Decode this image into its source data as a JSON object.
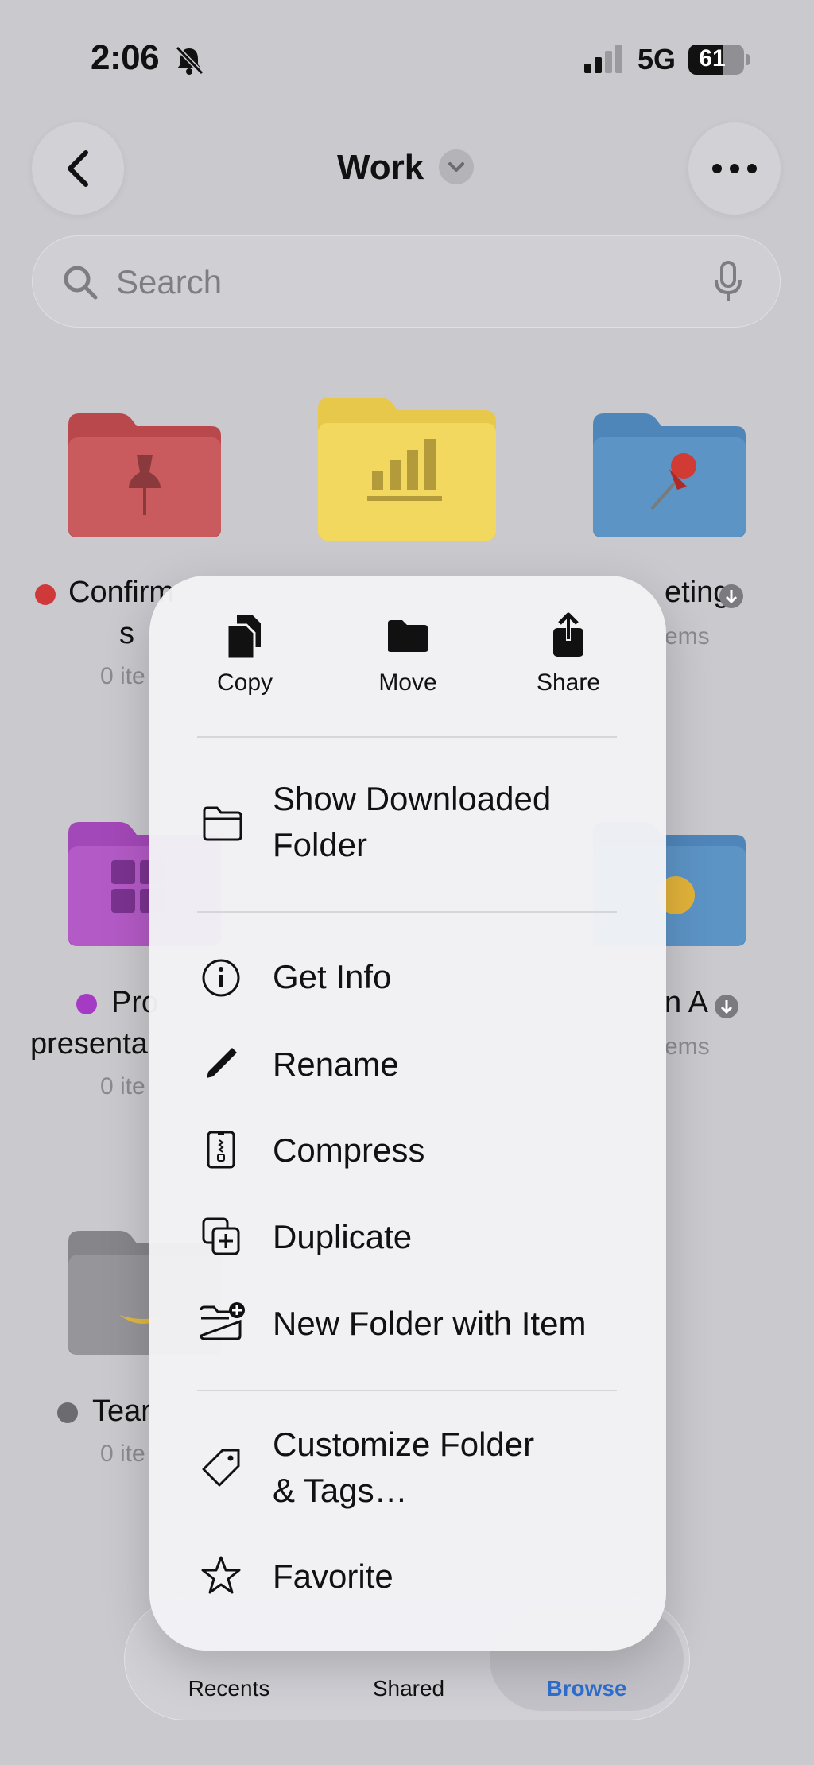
{
  "status_bar": {
    "time": "2:06",
    "network": "5G",
    "battery": "61",
    "battery_level": 0.61
  },
  "nav": {
    "title": "Work"
  },
  "search": {
    "placeholder": "Search"
  },
  "folders": [
    {
      "label_line1": "Confirm",
      "label_line2": "s",
      "count": "0 ite",
      "dot_color": "#d0393a"
    },
    {
      "label_line1": "eting",
      "count": "ems"
    },
    {
      "label_line1": "Pro",
      "label_line2": "presenta",
      "count": "0 ite",
      "dot_color": "#a53ac4"
    },
    {
      "label_line1": "n A",
      "count": "ems"
    },
    {
      "label_line1": "Tear",
      "count": "0 ite",
      "dot_color": "#6b6b70"
    }
  ],
  "context_menu": {
    "top_actions": [
      {
        "label": "Copy",
        "icon": "copy-icon"
      },
      {
        "label": "Move",
        "icon": "folder-move-icon"
      },
      {
        "label": "Share",
        "icon": "share-icon"
      }
    ],
    "group1": [
      {
        "label_line1": "Show Downloaded",
        "label_line2": "Folder",
        "icon": "folder-outline-icon"
      }
    ],
    "group2": [
      {
        "label": "Get Info",
        "icon": "info-icon"
      },
      {
        "label": "Rename",
        "icon": "pencil-icon"
      },
      {
        "label": "Compress",
        "icon": "archive-icon"
      },
      {
        "label": "Duplicate",
        "icon": "duplicate-icon"
      },
      {
        "label": "New Folder with Item",
        "icon": "folder-plus-icon"
      }
    ],
    "group3": [
      {
        "label_line1": "Customize Folder",
        "label_line2": "& Tags…",
        "icon": "tag-icon"
      },
      {
        "label": "Favorite",
        "icon": "star-icon"
      }
    ]
  },
  "tab_bar": {
    "tabs": [
      {
        "label": "Recents"
      },
      {
        "label": "Shared"
      },
      {
        "label": "Browse",
        "selected": true
      }
    ],
    "selected_color": "#2f6fd0"
  }
}
